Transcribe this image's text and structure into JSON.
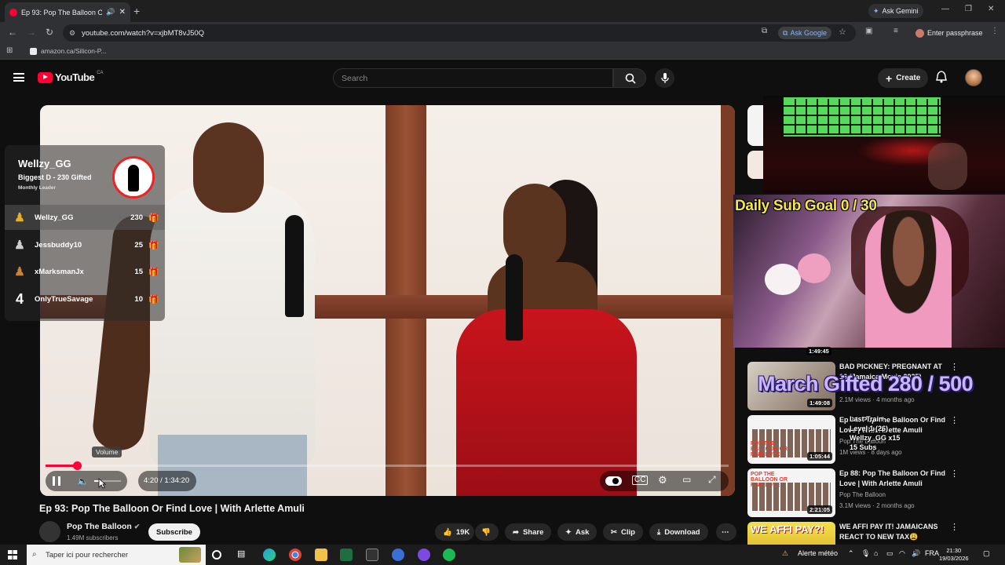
{
  "browser": {
    "tab_title": "Ep 93: Pop The Balloon Or F",
    "new_tab": "+",
    "ask_gemini": "Ask Gemini",
    "url": "youtube.com/watch?v=xjbMT8vJ50Q",
    "ask_google": "Ask Google",
    "enter_passphrase": "Enter passphrase",
    "bookmark": "amazon.ca/Silicon-P..."
  },
  "youtube": {
    "logo_text": "YouTube",
    "country": "CA",
    "search_placeholder": "Search",
    "create_label": "Create"
  },
  "leaderboard": {
    "leader_name": "Wellzy_GG",
    "leader_subtitle": "Biggest D - 230 Gifted",
    "leader_label": "Monthly Leader",
    "rows": [
      {
        "rank": "",
        "name": "Wellzy_GG",
        "count": "230"
      },
      {
        "rank": "",
        "name": "Jessbuddy10",
        "count": "25"
      },
      {
        "rank": "",
        "name": "xMarksmanJx",
        "count": "15"
      },
      {
        "rank": "4",
        "name": "OnlyTrueSavage",
        "count": "10"
      }
    ]
  },
  "player": {
    "volume_tooltip": "Volume",
    "time": "4:20 / 1:34:20",
    "progress_fraction": 0.046,
    "volume_fraction": 0.25
  },
  "video": {
    "title": "Ep 93: Pop The Balloon Or Find Love | With Arlette Amuli",
    "channel": "Pop The Balloon",
    "subscribers": "1.49M subscribers",
    "subscribe_label": "Subscribe",
    "likes": "19K",
    "share_label": "Share",
    "ask_label": "Ask",
    "clip_label": "Clip",
    "download_label": "Download"
  },
  "stream_overlay": {
    "sub_goal": "Daily Sub Goal  0 / 30",
    "march_gifted": "March Gifted  280 / 500",
    "last_train_1": "Last Train",
    "last_train_2": "Level 1 (26)",
    "last_train_3": "Wellzy_GG x15",
    "last_train_4": "15 Subs"
  },
  "sidebar": {
    "top_duration": "1:49:45",
    "items": [
      {
        "title": "BAD PICKNEY: PREGNANT AT 16 (Jamaica Movie 2025)",
        "channel": "",
        "meta": "2.1M views · 4 months ago",
        "duration": "1:49:08"
      },
      {
        "title": "Ep 94: Pop The Balloon Or Find Love | With Arlette Amuli",
        "channel": "Pop The Balloon",
        "meta": "1M views · 8 days ago",
        "duration": "1:05:44"
      },
      {
        "title": "Ep 88: Pop The Balloon Or Find Love | With Arlette Amuli",
        "channel": "Pop The Balloon",
        "meta": "3.1M views · 2 months ago",
        "duration": "2:21:05"
      },
      {
        "title": "WE AFFI PAY IT! JAMAICANS REACT TO NEW TAX😩",
        "channel": "",
        "meta": "",
        "duration": ""
      }
    ],
    "thumb_label": "POP THE BALLOON OR FIND LOVE",
    "thumb_label_4": "WE AFFI PAY?!"
  },
  "taskbar": {
    "search_placeholder": "Taper ici pour rechercher",
    "weather": "Alerte météo",
    "lang": "FRA",
    "time": "21:30",
    "date": "19/03/2026"
  },
  "colors": {
    "yt_red": "#ff0033",
    "bg": "#0f0f0f",
    "sub_goal_yellow": "#f5e64a",
    "gifted_purple": "#c9b6ff"
  }
}
